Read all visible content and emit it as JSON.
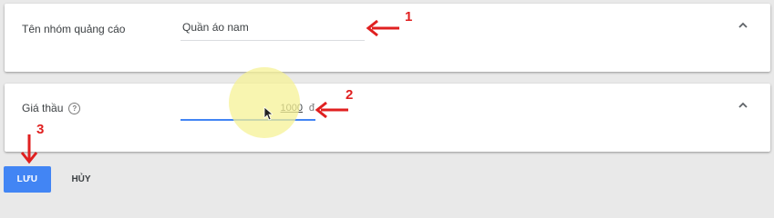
{
  "ad_group_name": {
    "label": "Tên nhóm quảng cáo",
    "value": "Quần áo nam"
  },
  "bid": {
    "label": "Giá thầu",
    "help_icon": "?",
    "value": "1000",
    "currency": "đ"
  },
  "actions": {
    "save_label": "LƯU",
    "cancel_label": "HỦY"
  },
  "annotations": {
    "step_1": "1",
    "step_2": "2",
    "step_3": "3",
    "arrow_color": "#e02020"
  },
  "colors": {
    "primary": "#4285f4",
    "highlight": "#f6f296",
    "background": "#e9e9e9"
  }
}
